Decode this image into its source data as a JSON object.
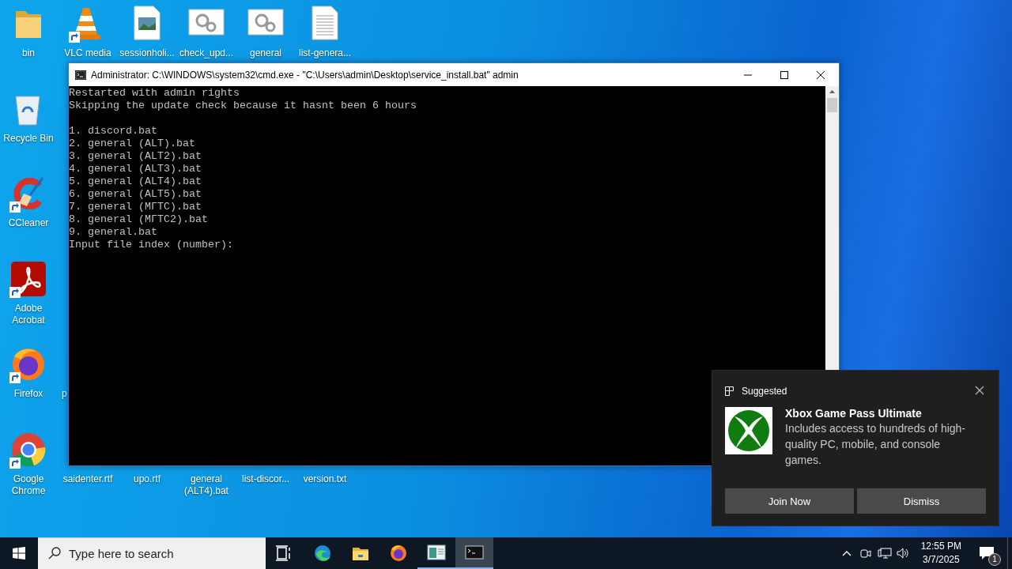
{
  "desktop_icons": [
    {
      "label": "bin",
      "kind": "folder",
      "shortcut": false
    },
    {
      "label": "VLC media",
      "kind": "vlc",
      "shortcut": true
    },
    {
      "label": "sessionholi...",
      "kind": "image-file",
      "shortcut": false
    },
    {
      "label": "check_upd...",
      "kind": "gear-file",
      "shortcut": false
    },
    {
      "label": "general",
      "kind": "gear-file",
      "shortcut": false
    },
    {
      "label": "list-genera...",
      "kind": "text-file",
      "shortcut": false
    },
    {
      "label": "Recycle Bin",
      "kind": "recycle-bin",
      "shortcut": false
    },
    {
      "label": "CCleaner",
      "kind": "ccleaner",
      "shortcut": true
    },
    {
      "label": "Adobe Acrobat",
      "kind": "acrobat",
      "shortcut": true
    },
    {
      "label": "Firefox",
      "kind": "firefox",
      "shortcut": true
    },
    {
      "label": "p",
      "kind": "label-only",
      "shortcut": false
    },
    {
      "label": "Google Chrome",
      "kind": "chrome",
      "shortcut": true
    },
    {
      "label": "saidenter.rtf",
      "kind": "label-only",
      "shortcut": false
    },
    {
      "label": "upo.rtf",
      "kind": "label-only",
      "shortcut": false
    },
    {
      "label": "general (ALT4).bat",
      "kind": "label-only",
      "shortcut": false
    },
    {
      "label": "list-discor...",
      "kind": "label-only",
      "shortcut": false
    },
    {
      "label": "version.txt",
      "kind": "label-only",
      "shortcut": false
    }
  ],
  "window": {
    "title": "Administrator: C:\\WINDOWS\\system32\\cmd.exe - \"C:\\Users\\admin\\Desktop\\service_install.bat\"  admin",
    "console_blocks": [
      [
        "Restarted with admin rights",
        "Skipping the update check because it hasnt been 6 hours"
      ],
      [
        "1. discord.bat",
        "2. general (ALT).bat",
        "3. general (ALT2).bat",
        "4. general (ALT3).bat",
        "5. general (ALT4).bat",
        "6. general (ALT5).bat",
        "7. general (МГТС).bat",
        "8. general (МГТС2).bat",
        "9. general.bat",
        "Input file index (number):"
      ]
    ]
  },
  "toast": {
    "header": "Suggested",
    "title": "Xbox Game Pass Ultimate",
    "body": "Includes access to hundreds of high-quality PC, mobile, and console games.",
    "buttons": [
      "Join Now",
      "Dismiss"
    ]
  },
  "taskbar": {
    "search": {
      "placeholder": "Type here to search"
    },
    "apps": [
      {
        "kind": "task-view",
        "running": false,
        "active": false
      },
      {
        "kind": "edge",
        "running": false,
        "active": false
      },
      {
        "kind": "explorer",
        "running": false,
        "active": false
      },
      {
        "kind": "firefox",
        "running": false,
        "active": false
      },
      {
        "kind": "app-window",
        "running": true,
        "active": false
      },
      {
        "kind": "cmd",
        "running": true,
        "active": true
      }
    ],
    "time": "12:55 PM",
    "date": "3/7/2025",
    "notification_count": "1"
  }
}
